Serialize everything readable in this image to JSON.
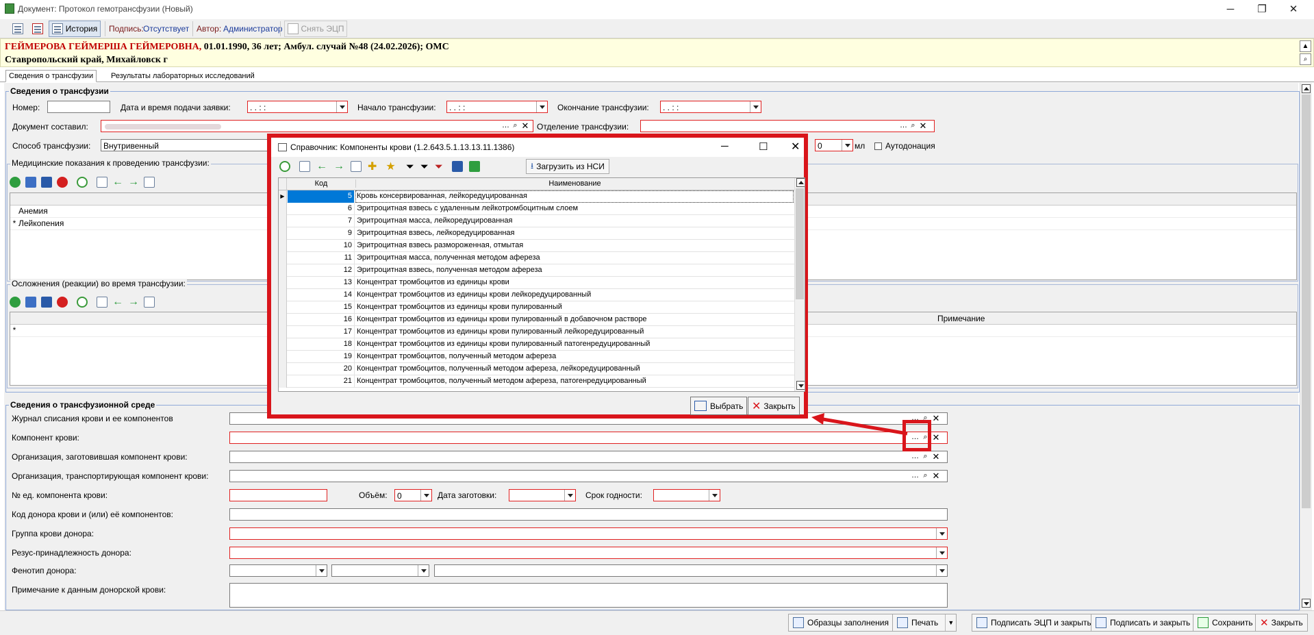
{
  "window": {
    "title": "Документ: Протокол гемотрансфузии (Новый)"
  },
  "toolbar": {
    "history_label": "История",
    "signature_label": "Подпись:",
    "signature_value": "Отсутствует",
    "author_label": "Автор:",
    "author_value": "Администратор",
    "remove_ecp_label": "Снять ЭЦП"
  },
  "patient": {
    "name": "ГЕЙМЕРОВА ГЕЙМЕРША ГЕЙМЕРОВНА,",
    "details": " 01.01.1990, 36 лет; Амбул. случай №48 (24.02.2026); ОМС",
    "address": "Ставропольский край, Михайловск г"
  },
  "tabs": [
    {
      "label": "Сведения о трансфузии"
    },
    {
      "label": "Результаты лабораторных исследований"
    }
  ],
  "transfusion": {
    "legend": "Сведения о трансфузии",
    "number_label": "Номер:",
    "request_dt_label": "Дата и время подачи заявки:",
    "start_label": "Начало трансфузии:",
    "end_label": "Окончание трансфузии:",
    "dt_mask": " .  .       :  :",
    "doc_author_label": "Документ составил:",
    "department_label": "Отделение трансфузии:",
    "method_label": "Способ трансфузии:",
    "method_value": "Внутривенный",
    "volume_value": "0",
    "ml_label": "мл",
    "autodonation_label": "Аутодонация"
  },
  "indications": {
    "legend": "Медицинские показания к проведению трансфузии:",
    "rows": [
      {
        "mark": "",
        "text": "Анемия"
      },
      {
        "mark": "*",
        "text": "Лейкопения"
      }
    ]
  },
  "complications": {
    "legend": "Осложнения (реакции) во время трансфузии:",
    "note_header": "Примечание",
    "new_row_mark": "*"
  },
  "medium": {
    "legend": "Сведения о трансфузионной среде",
    "journal_label": "Журнал списания крови и ее компонентов",
    "component_label": "Компонент крови:",
    "org_prep_label": "Организация, заготовившая компонент крови:",
    "org_trans_label": "Организация, транспортирующая компонент крови:",
    "unit_no_label": "№ ед. компонента крови:",
    "volume_label": "Объём:",
    "volume_value": "0",
    "prep_date_label": "Дата заготовки:",
    "expiry_label": "Срок годности:",
    "donor_code_label": "Код донора крови и (или) её компонентов:",
    "donor_group_label": "Группа крови донора:",
    "donor_rh_label": "Резус-принадлежность донора:",
    "donor_pheno_label": "Фенотип донора:",
    "donor_note_label": "Примечание к данным донорской крови:"
  },
  "modal": {
    "title": "Справочник: Компоненты крови (1.2.643.5.1.13.13.11.1386)",
    "load_nsi_label": "Загрузить из НСИ",
    "col_code": "Код",
    "col_name": "Наименование",
    "rows": [
      {
        "code": "5",
        "name": "Кровь консервированная, лейкоредуцированная"
      },
      {
        "code": "6",
        "name": "Эритроцитная взвесь с удаленным лейкотромбоцитным слоем"
      },
      {
        "code": "7",
        "name": "Эритроцитная масса, лейкоредуцированная"
      },
      {
        "code": "9",
        "name": "Эритроцитная взвесь, лейкоредуцированная"
      },
      {
        "code": "10",
        "name": "Эритроцитная взвесь размороженная, отмытая"
      },
      {
        "code": "11",
        "name": "Эритроцитная масса, полученная методом афереза"
      },
      {
        "code": "12",
        "name": "Эритроцитная взвесь, полученная методом афереза"
      },
      {
        "code": "13",
        "name": "Концентрат тромбоцитов из единицы крови"
      },
      {
        "code": "14",
        "name": "Концентрат тромбоцитов из единицы крови лейкоредуцированный"
      },
      {
        "code": "15",
        "name": "Концентрат тромбоцитов из единицы крови пулированный"
      },
      {
        "code": "16",
        "name": "Концентрат тромбоцитов из единицы крови пулированный в добавочном растворе"
      },
      {
        "code": "17",
        "name": "Концентрат тромбоцитов из единицы крови пулированный лейкоредуцированный"
      },
      {
        "code": "18",
        "name": "Концентрат тромбоцитов из единицы крови пулированный патогенредуцированный"
      },
      {
        "code": "19",
        "name": "Концентрат тромбоцитов, полученный методом афереза"
      },
      {
        "code": "20",
        "name": "Концентрат тромбоцитов, полученный методом афереза, лейкоредуцированный"
      },
      {
        "code": "21",
        "name": "Концентрат тромбоцитов, полученный методом афереза, патогенредуцированный"
      }
    ],
    "select_label": "Выбрать",
    "close_label": "Закрыть"
  },
  "footer": {
    "samples_label": "Образцы заполнения",
    "print_label": "Печать",
    "sign_ecp_close_label": "Подписать ЭЦП и закрыть",
    "sign_close_label": "Подписать и закрыть",
    "save_label": "Сохранить",
    "close_label": "Закрыть"
  },
  "colors": {
    "accent_red": "#d9151b",
    "selection": "#0078d7",
    "required_border": "#e02020",
    "patient_bg": "#ffffe0"
  }
}
